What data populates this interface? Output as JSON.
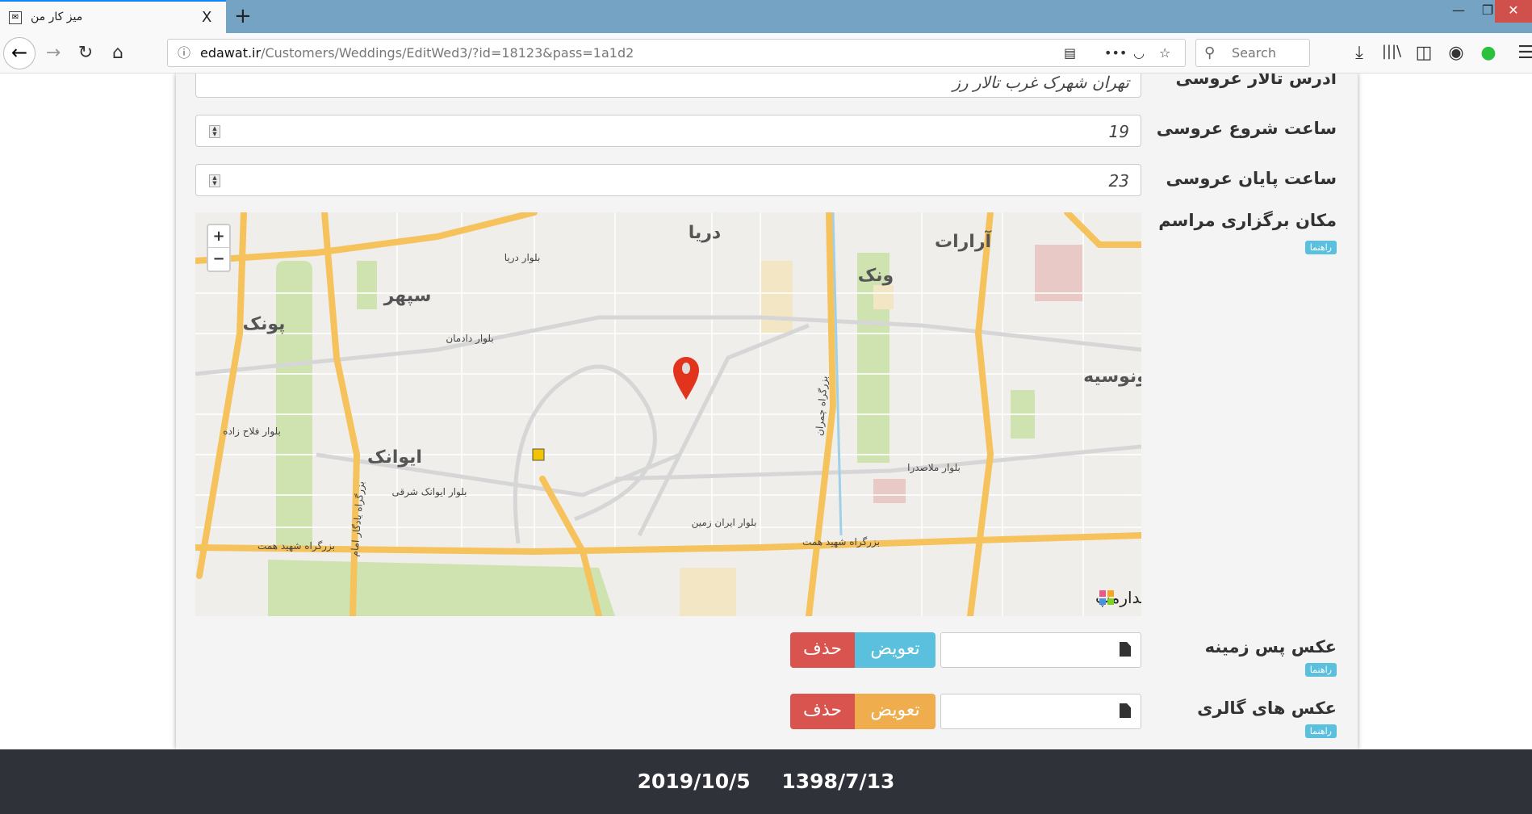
{
  "browser": {
    "tab_title": "میز کار من",
    "tab_close": "X",
    "new_tab": "+",
    "url_host": "edawat.ir",
    "url_path": "/Customers/Weddings/EditWed3/?id=18123&pass=1a1d2",
    "search_placeholder": "Search",
    "icons": [
      "back-icon",
      "forward-icon",
      "reload-icon",
      "home-icon",
      "info-icon",
      "reader-view-icon",
      "more-icon",
      "pocket-icon",
      "bookmark-star-icon",
      "download-icon",
      "library-icon",
      "sidebar-icon",
      "account-icon",
      "extension-check-icon",
      "menu-icon"
    ]
  },
  "form": {
    "address": {
      "label": "آدرس تالار عروسی",
      "value": "تهران شهرک غرب تالار رز"
    },
    "start_hour": {
      "label": "ساعت شروع عروسی",
      "value": "19"
    },
    "end_hour": {
      "label": "ساعت پایان عروسی",
      "value": "23"
    },
    "location": {
      "label": "مکان برگزاری مراسم",
      "help": "راهنما"
    },
    "background_photo": {
      "label": "عکس پس زمینه",
      "help": "راهنما",
      "replace": "تعویض",
      "delete": "حذف",
      "replace_color": "#5bc0de"
    },
    "gallery_photos": {
      "label": "عکس های گالری",
      "help": "راهنما",
      "replace": "تعویض",
      "delete": "حذف",
      "replace_color": "#f0ad4e"
    }
  },
  "map": {
    "zoom_in": "+",
    "zoom_out": "−",
    "places": [
      "سپهر",
      "پونک",
      "ایوانک",
      "دریا",
      "ونک",
      "آرارات",
      "ونوسیه"
    ],
    "roads": [
      "بزرگراه شهید همت",
      "بزرگراه شهید همت",
      "بزرگراه یادگار امام",
      "بزرگراه چمران",
      "بلوار دادمان",
      "بلوار دریا",
      "بلوار ایوانک شرقی",
      "بلوار ملاصدرا",
      "بلوار فلاح زاده",
      "بلوار ایران زمین"
    ],
    "logo": "سیدارمپ",
    "marker_color": "#e2341d"
  },
  "footer": {
    "gregorian_date": "2019/10/5",
    "persian_date": "1398/7/13"
  }
}
